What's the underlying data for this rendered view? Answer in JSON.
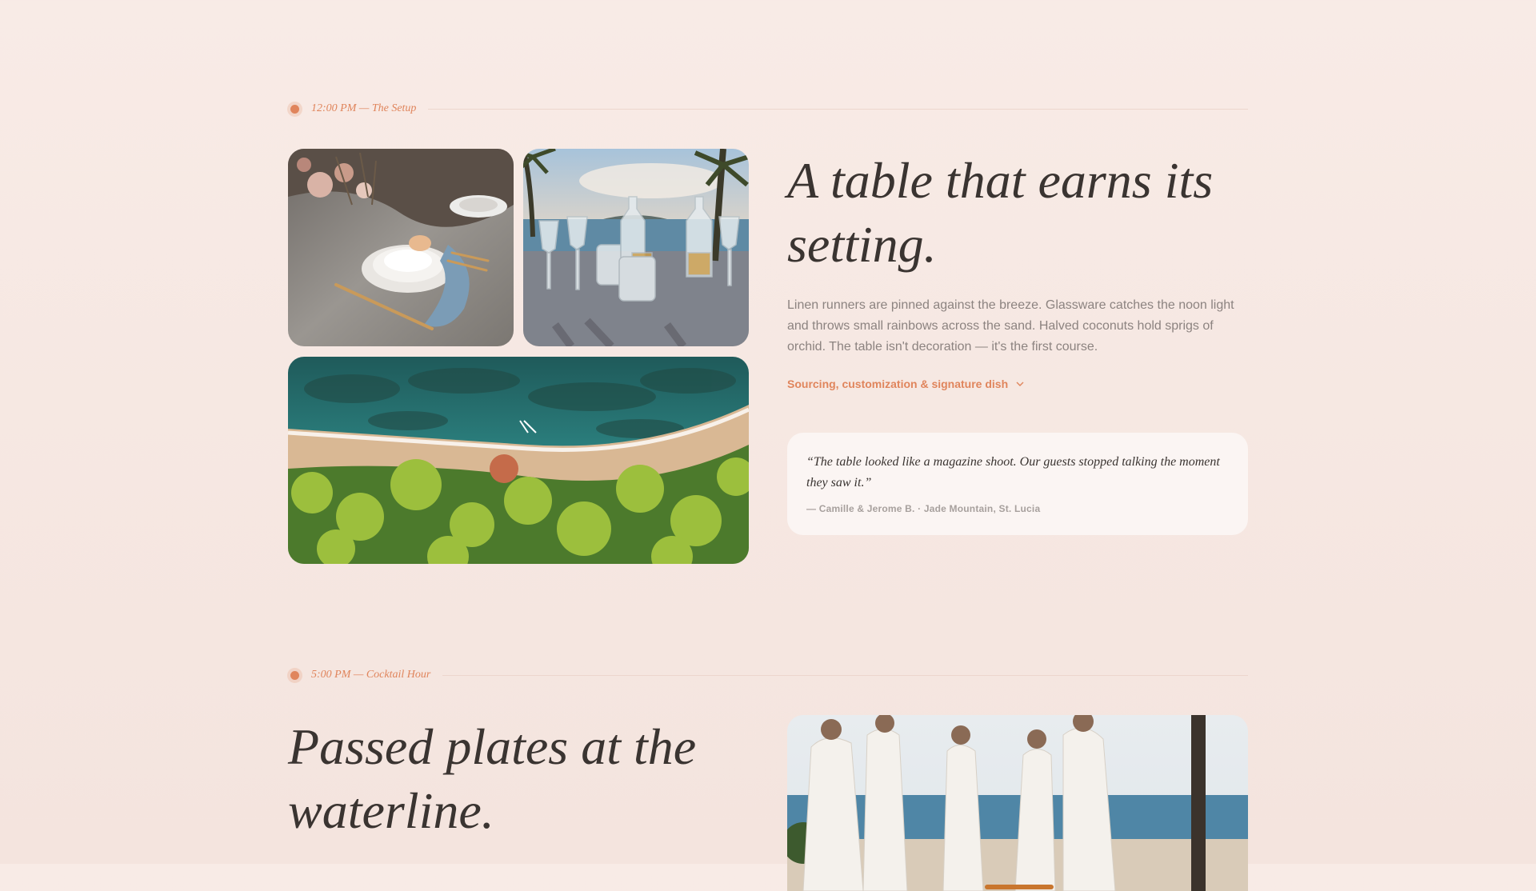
{
  "setup": {
    "time_label": "12:00 PM — The Setup",
    "headline_line1": "A table that earns its",
    "headline_line2": "setting.",
    "body": "Linen runners are pinned against the breeze. Glassware catches the noon light and throws small rainbows across the sand. Halved coconuts hold sprigs of orchid. The table isn't decoration — it's the first course.",
    "details_link": "Sourcing, customization & signature dish",
    "quote": {
      "text": "“The table looked like a magazine shoot. Our guests stopped talking the moment they saw it.”",
      "attribution": "— Camille & Jerome B. · Jade Mountain, St. Lucia"
    }
  },
  "cocktail": {
    "time_label": "5:00 PM — Cocktail Hour",
    "headline_line1": "Passed plates at the",
    "headline_line2": "waterline."
  },
  "colors": {
    "accent": "#e0855c",
    "text": "#3a3431",
    "muted": "#8c8380",
    "card": "#fbf5f3"
  }
}
